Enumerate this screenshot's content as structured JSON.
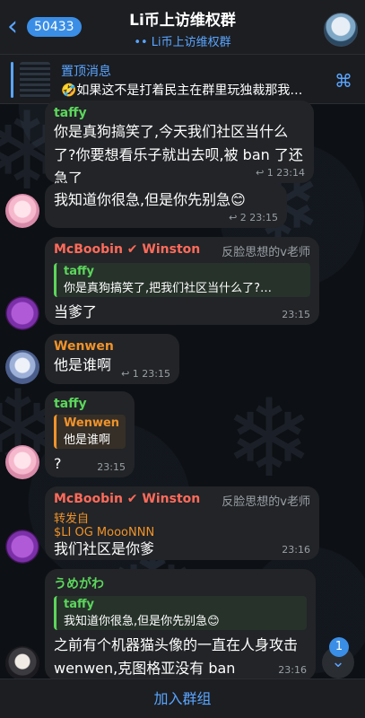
{
  "header": {
    "back_icon": "chevron-left-icon",
    "unread_count": "50433",
    "title": "Li币上访维权群",
    "subtitle": "•• Li币上访维权群"
  },
  "pinned": {
    "title": "置顶消息",
    "text": "🤣如果这不是打着民主在群里玩独裁那我…"
  },
  "messages": [
    {
      "sender": "taffy",
      "sender_color": "#5cd65c",
      "text": "你是真狗搞笑了,今天我们社区当什么了?你要想看乐子就出去呗,被 ban 了还急了",
      "meta": "↩ 1  23:14"
    },
    {
      "text": "我知道你很急,但是你先别急😊",
      "meta": "↩ 2  23:15"
    },
    {
      "sender": "McBoobin ✔ Winston",
      "sender_color": "#ff6b5b",
      "role": "反脸思想的v老师",
      "reply_name": "taffy",
      "reply_text": "你是真狗搞笑了,把我们社区当什么了?…",
      "text": "当爹了",
      "meta": "23:15"
    },
    {
      "sender": "Wenwen",
      "sender_color": "#f0932b",
      "text": "他是谁啊",
      "meta": "↩ 1  23:15"
    },
    {
      "sender": "taffy",
      "sender_color": "#5cd65c",
      "reply_name": "Wenwen",
      "reply_text": "他是谁啊",
      "text": "?",
      "meta": "23:15"
    },
    {
      "sender": "McBoobin ✔ Winston",
      "sender_color": "#ff6b5b",
      "role": "反脸思想的v老师",
      "forward_label": "转发自",
      "forward_from": "$LI OG MoooNNN",
      "text": "我们社区是你爹",
      "meta": "23:16"
    },
    {
      "sender": "うめがわ",
      "sender_color": "#5cd65c",
      "reply_name": "taffy",
      "reply_text": "我知道你很急,但是你先别急😊",
      "text": "之前有个机器猫头像的一直在人身攻击 wenwen,克图格亚没有 ban",
      "meta": "23:16"
    }
  ],
  "scroll": {
    "count": "1"
  },
  "join_button": "加入群组"
}
